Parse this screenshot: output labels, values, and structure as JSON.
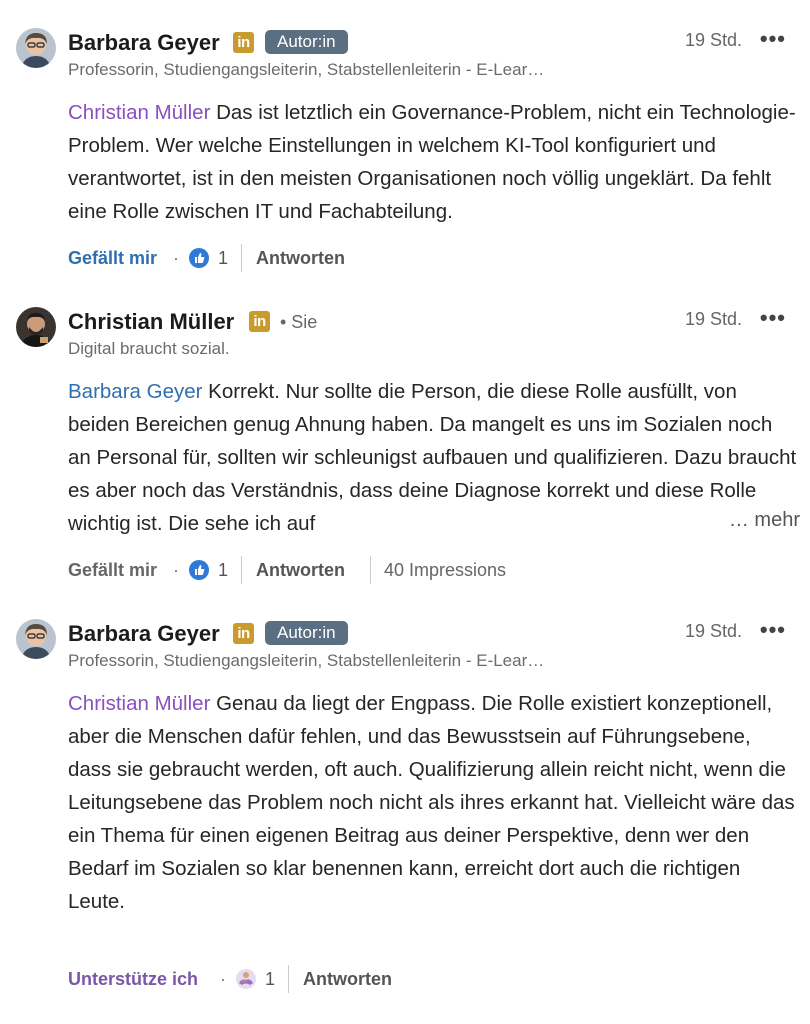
{
  "comments": [
    {
      "author": "Barbara Geyer",
      "li_badge": "in",
      "badge": "Autor:in",
      "time": "19 Std.",
      "more": "•••",
      "headline": "Professorin, Studiengangsleiterin, Stabstellenleiterin - E-Lear…",
      "mention": "Christian Müller",
      "text": " Das ist letztlich ein Governance-Problem, nicht ein Technologie-Problem. Wer welche Einstellungen in welchem KI-Tool konfiguriert und verantwortet, ist in den meisten Organisationen noch völlig ungeklärt. Da fehlt eine Rolle zwischen IT und Fachabteilung.",
      "like_label": "Gefällt mir",
      "dot": "·",
      "reaction_icon": "like-thumb-icon",
      "reaction_count": "1",
      "reply_label": "Antworten"
    },
    {
      "author": "Christian Müller",
      "li_badge": "in",
      "you_label": "• Sie",
      "time": "19 Std.",
      "more": "•••",
      "headline": "Digital braucht sozial.",
      "mention": "Barbara Geyer",
      "text": " Korrekt. Nur sollte die Person, die diese Rolle ausfüllt, von beiden Bereichen genug Ahnung haben. Da mangelt es uns im Sozialen noch an Personal für, sollten wir schleunigst aufbauen und qualifizieren. Dazu braucht es aber noch das Verständnis, dass deine Diagnose korrekt und diese Rolle wichtig ist. Die sehe ich auf",
      "see_more": "… mehr",
      "like_label": "Gefällt mir",
      "dot": "·",
      "reaction_icon": "like-thumb-icon",
      "reaction_count": "1",
      "reply_label": "Antworten",
      "impressions": "40 Impressions"
    },
    {
      "author": "Barbara Geyer",
      "li_badge": "in",
      "badge": "Autor:in",
      "time": "19 Std.",
      "more": "•••",
      "headline": "Professorin, Studiengangsleiterin, Stabstellenleiterin - E-Lear…",
      "mention": "Christian Müller",
      "text": " Genau da liegt der Engpass. Die Rolle existiert konzeptionell, aber die Menschen dafür fehlen, und das Bewusstsein auf Führungsebene, dass sie gebraucht werden, oft auch. Qualifizierung allein reicht nicht, wenn die Leitungsebene das Problem noch nicht als ihres erkannt hat. Vielleicht wäre das ein Thema für einen eigenen Beitrag aus deiner Perspektive, denn wer den Bedarf im Sozialen so klar benennen kann, erreicht dort auch die richtigen Leute.",
      "like_label": "Unterstütze ich",
      "dot": "·",
      "reaction_icon": "support-hands-icon",
      "reaction_count": "1",
      "reply_label": "Antworten"
    }
  ],
  "colors": {
    "mention_purple": "#8a4fc0",
    "mention_blue": "#2f6fb0",
    "linkedin_badge": "#c99a2e",
    "author_badge": "#5b6e82"
  }
}
